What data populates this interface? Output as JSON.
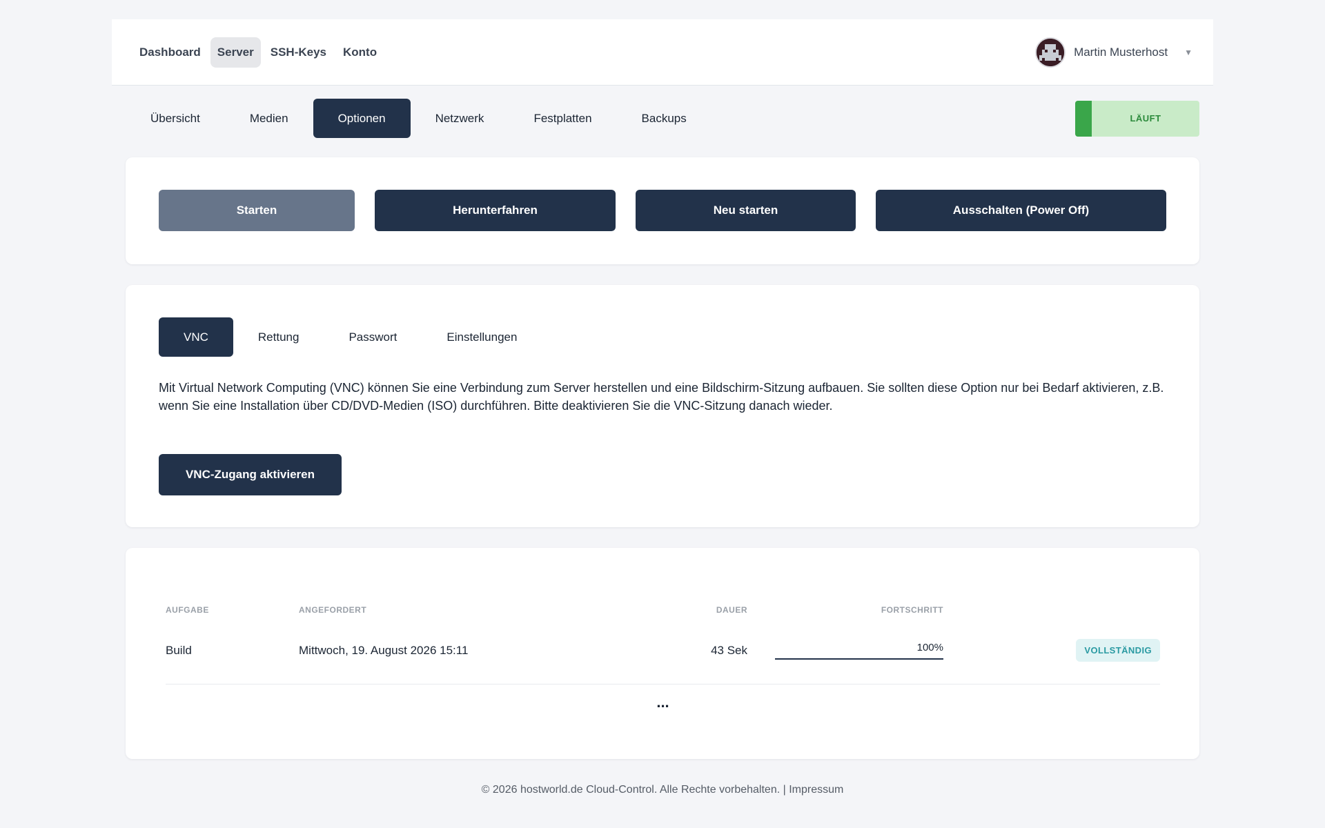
{
  "nav": {
    "items": [
      {
        "label": "Dashboard",
        "active": false
      },
      {
        "label": "Server",
        "active": true
      },
      {
        "label": "SSH-Keys",
        "active": false
      },
      {
        "label": "Konto",
        "active": false
      }
    ],
    "user": {
      "name": "Martin Musterhost",
      "avatar_icon": "avatar-pixel-icon",
      "caret_icon": "caret-down-icon"
    }
  },
  "server_tabs": {
    "items": [
      {
        "label": "Übersicht",
        "active": false
      },
      {
        "label": "Medien",
        "active": false
      },
      {
        "label": "Optionen",
        "active": true
      },
      {
        "label": "Netzwerk",
        "active": false
      },
      {
        "label": "Festplatten",
        "active": false
      },
      {
        "label": "Backups",
        "active": false
      }
    ],
    "status": {
      "label": "LÄUFT",
      "color": "#3aa64a"
    }
  },
  "power": {
    "start": "Starten",
    "shutdown": "Herunterfahren",
    "restart": "Neu starten",
    "poweroff": "Ausschalten (Power Off)"
  },
  "options": {
    "tabs": [
      {
        "label": "VNC",
        "active": true
      },
      {
        "label": "Rettung",
        "active": false
      },
      {
        "label": "Passwort",
        "active": false
      },
      {
        "label": "Einstellungen",
        "active": false
      }
    ],
    "vnc": {
      "description": "Mit Virtual Network Computing (VNC) können Sie eine Verbindung zum Server herstellen und eine Bildschirm-Sitzung aufbauen. Sie sollten diese Option nur bei Bedarf aktivieren, z.B. wenn Sie eine Installation über CD/DVD-Medien (ISO) durchführen. Bitte deaktivieren Sie die VNC-Sitzung danach wieder.",
      "button": "VNC-Zugang aktivieren"
    }
  },
  "tasks": {
    "headers": {
      "task": "AUFGABE",
      "requested": "ANGEFORDERT",
      "duration": "DAUER",
      "progress": "FORTSCHRITT"
    },
    "rows": [
      {
        "task": "Build",
        "requested": "Mittwoch, 19. August 2026 15:11",
        "duration": "43 Sek",
        "progress_label": "100%",
        "progress": 1.0,
        "status": "VOLLSTÄNDIG"
      }
    ],
    "more": "..."
  },
  "footer": {
    "text": "© 2026 hostworld.de Cloud-Control. Alle Rechte vorbehalten. | ",
    "link": "Impressum"
  },
  "colors": {
    "primary": "#22324a",
    "success": "#3aa64a",
    "badge": "#2a9aa2"
  }
}
